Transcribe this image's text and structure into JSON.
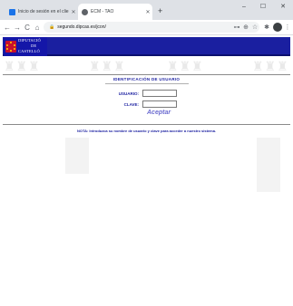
{
  "browser": {
    "tabs": [
      {
        "title": "Inicio de sesión en el cliente ext",
        "active": false,
        "favicon_color": "#1a73e8"
      },
      {
        "title": "ECM - TAO",
        "active": true,
        "favicon_color": "#5f6368"
      }
    ],
    "new_tab_symbol": "+",
    "window": {
      "minimize": "–",
      "maximize": "☐",
      "close": "✕"
    },
    "nav": {
      "back": "←",
      "forward": "→",
      "reload": "C",
      "home": "⌂"
    },
    "address": "segundo.dipcas.es/jcon/",
    "toolbar_icons": {
      "key": "⊶",
      "zoom": "⊕",
      "star": "☆",
      "extensions": "✱"
    }
  },
  "site": {
    "logo_lines": [
      "DIPUTACIÓ",
      "DE",
      "CASTELLÓ"
    ],
    "brand_color": "#1a1fa0"
  },
  "login": {
    "title": "IDENTIFICACIÓN DE USUARIO",
    "user_label": "USUARIO:",
    "user_value": "",
    "password_label": "CLAVE:",
    "password_value": "",
    "accept_label": "Aceptar"
  },
  "note": "NOTA: Introduzca su nombre de usuario y clave para acceder a nuestro sistema."
}
